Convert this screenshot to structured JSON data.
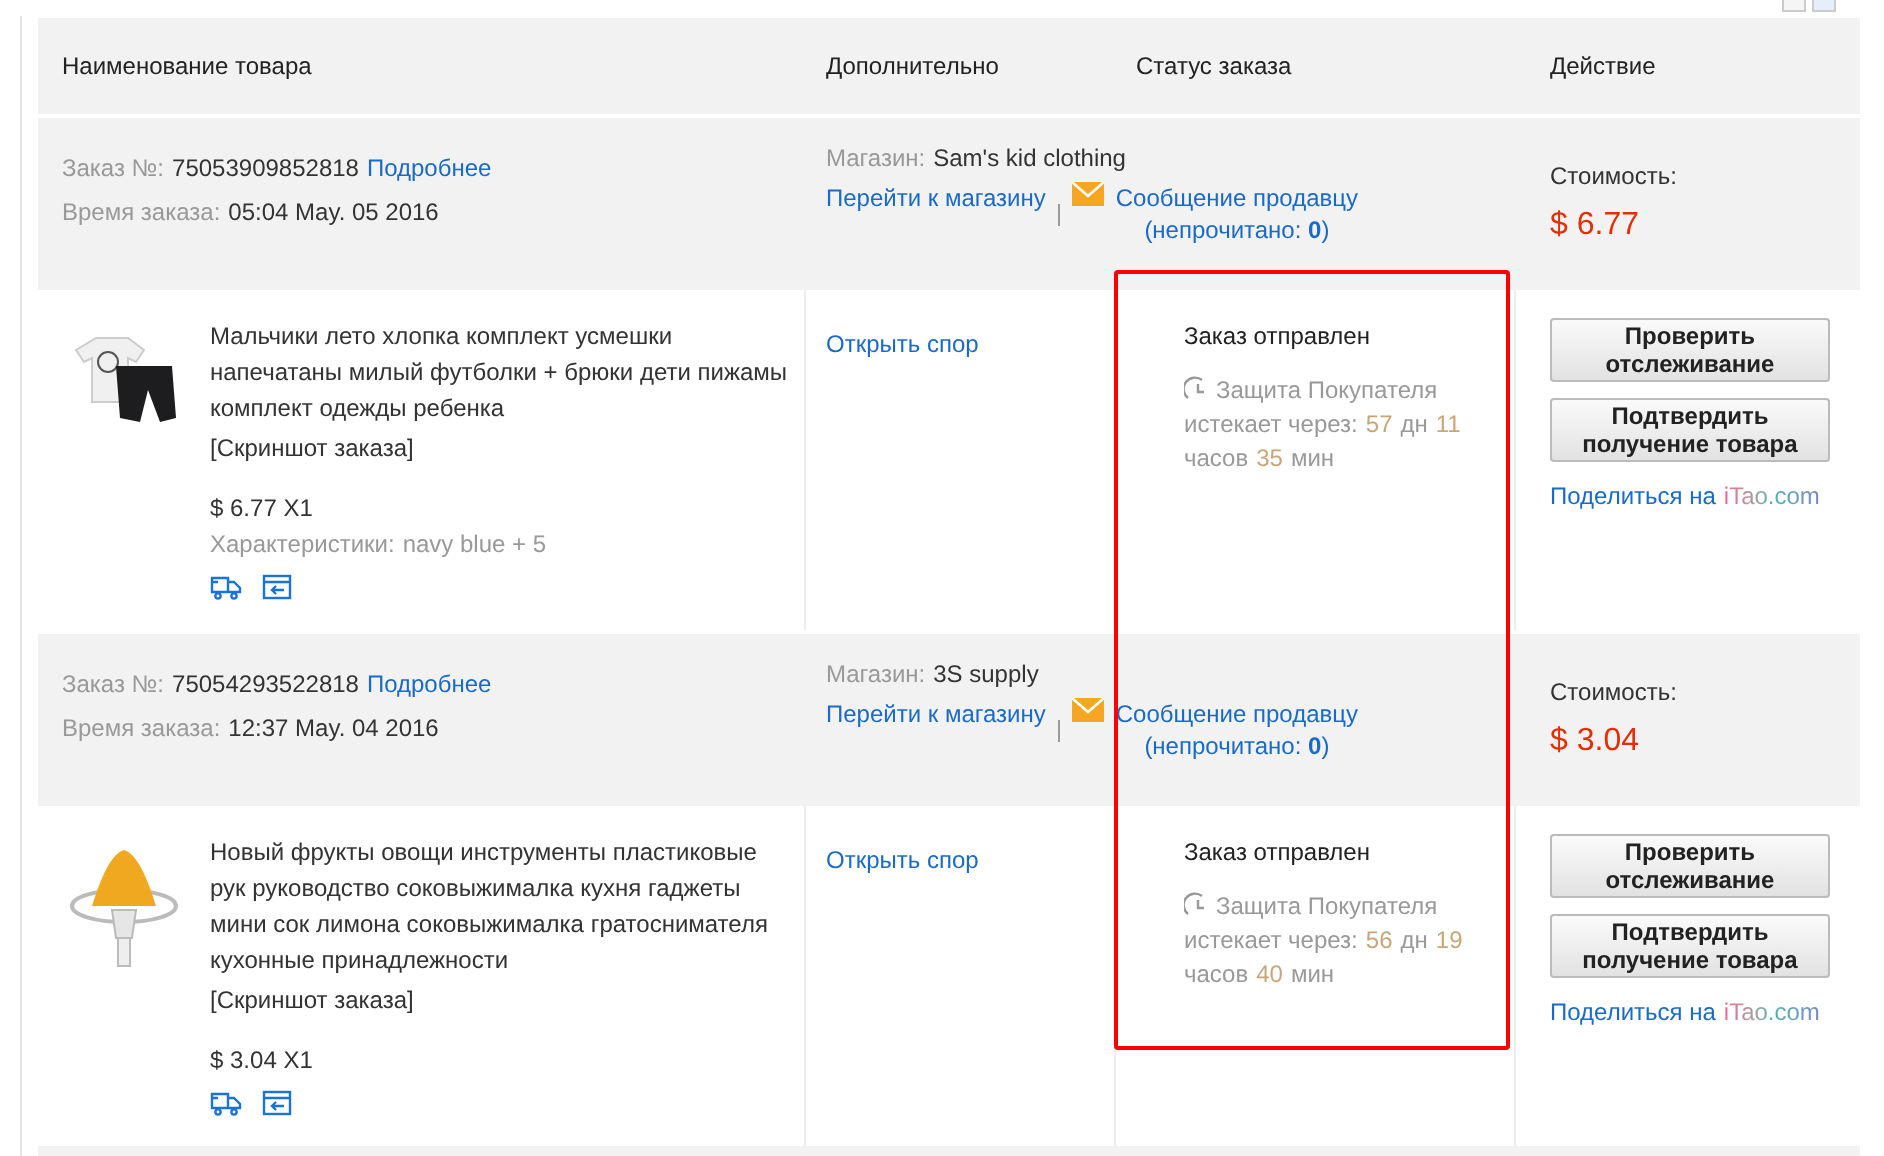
{
  "table": {
    "columns": [
      "Наименование товара",
      "Дополнительно",
      "Статус заказа",
      "Действие"
    ],
    "orders": [
      {
        "order_label": "Заказ №:",
        "order_no": "75053909852818",
        "details_link": "Подробнее",
        "time_label": "Время заказа:",
        "time": "05:04 May. 05 2016",
        "store_label": "Магазин:",
        "store": "Sam's kid clothing",
        "store_link": "Перейти к магазину",
        "message_link": "Сообщение продавцу",
        "unread": "(непрочитано: **0**)",
        "cost_label": "Стоимость:",
        "cost": "$ 6.77",
        "item": {
          "kind": "clothes",
          "title": "Мальчики лето хлопка комплект усмешки напечатаны милый футболки + брюки дети пижамы комплект одежды ребенка",
          "snapshot": "[Скриншот заказа]",
          "price": "$ 6.77 X1",
          "specs_label": "Характеристики:",
          "specs": "navy blue + 5",
          "dispute_link": "Открыть спор",
          "status": "Заказ отправлен",
          "protection": "Защита Покупателя",
          "countdown": [
            {
              "kind": "label",
              "text": "истекает через:"
            },
            {
              "kind": "value",
              "text": "57"
            },
            {
              "kind": "label",
              "text": "дн"
            },
            {
              "kind": "value",
              "text": "11"
            },
            {
              "kind": "label",
              "text": "часов"
            },
            {
              "kind": "value",
              "text": "35"
            },
            {
              "kind": "label",
              "text": "мин"
            }
          ],
          "buttons": [
            "Проверить отслеживание",
            "Подтвердить получение товара"
          ],
          "share_label": "Поделиться на",
          "share_site": "iTao.com"
        }
      },
      {
        "order_label": "Заказ №:",
        "order_no": "75054293522818",
        "details_link": "Подробнее",
        "time_label": "Время заказа:",
        "time": "12:37 May. 04 2016",
        "store_label": "Магазин:",
        "store": "3S supply",
        "store_link": "Перейти к магазину",
        "message_link": "Сообщение продавцу",
        "unread": "(непрочитано: **0**)",
        "cost_label": "Стоимость:",
        "cost": "$ 3.04",
        "item": {
          "kind": "juicer",
          "title": "Новый фрукты овощи инструменты пластиковые рук руководство соковыжималка кухня гаджеты мини сок лимона соковыжималка гратоснимателя кухонные принадлежности",
          "snapshot": "[Скриншот заказа]",
          "price": "$ 3.04 X1",
          "dispute_link": "Открыть спор",
          "status": "Заказ отправлен",
          "protection": "Защита Покупателя",
          "countdown": [
            {
              "kind": "label",
              "text": "истекает через:"
            },
            {
              "kind": "value",
              "text": "56"
            },
            {
              "kind": "label",
              "text": "дн"
            },
            {
              "kind": "value",
              "text": "19"
            },
            {
              "kind": "label",
              "text": "часов"
            },
            {
              "kind": "value",
              "text": "40"
            },
            {
              "kind": "label",
              "text": "мин"
            }
          ],
          "buttons": [
            "Проверить отслеживание",
            "Подтвердить получение товара"
          ],
          "share_label": "Поделиться на",
          "share_site": "iTao.com"
        }
      }
    ]
  }
}
